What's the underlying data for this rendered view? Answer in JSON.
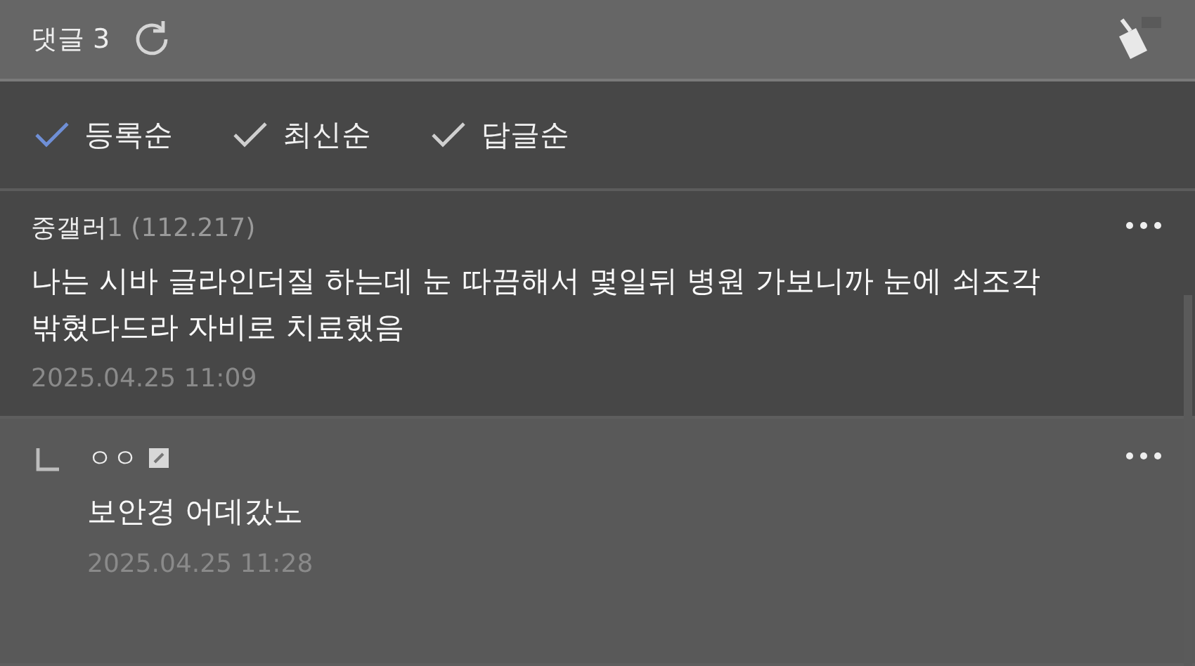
{
  "header": {
    "title": "댓글 3"
  },
  "sort_options": [
    {
      "label": "등록순",
      "selected": true
    },
    {
      "label": "최신순",
      "selected": false
    },
    {
      "label": "답글순",
      "selected": false
    }
  ],
  "comments": [
    {
      "kind": "comment",
      "author": "중갤러",
      "author_suffix": "1 (112.217)",
      "text": "나는 시바 글라인더질 하는데 눈 따끔해서 몇일뒤 병원 가보니까 눈에 쇠조각 밖혔다드라 자비로 치료했음",
      "date": "2025.04.25 11:09"
    },
    {
      "kind": "reply",
      "author": "ㅇㅇ",
      "text": "보안경 어데갔노",
      "date": "2025.04.25 11:28"
    }
  ]
}
